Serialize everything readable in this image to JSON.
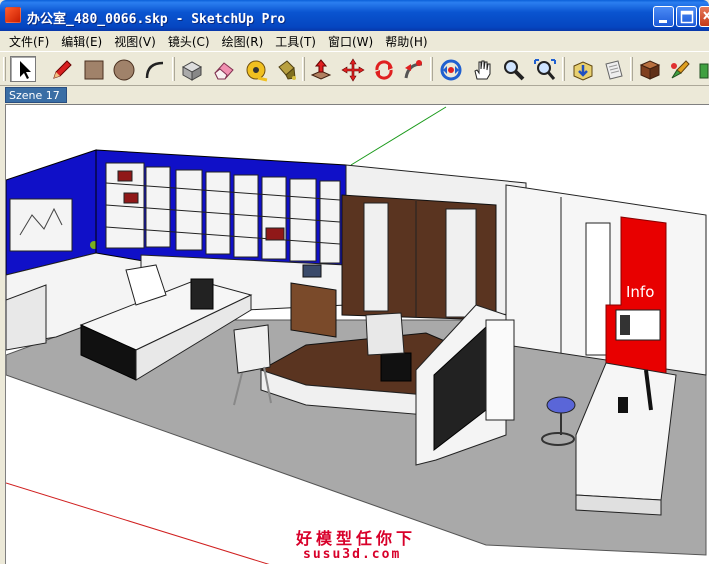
{
  "window": {
    "title": "办公室_480_0066.skp - SketchUp Pro"
  },
  "menu": [
    {
      "label": "文件(F)"
    },
    {
      "label": "编辑(E)"
    },
    {
      "label": "视图(V)"
    },
    {
      "label": "镜头(C)"
    },
    {
      "label": "绘图(R)"
    },
    {
      "label": "工具(T)"
    },
    {
      "label": "窗口(W)"
    },
    {
      "label": "帮助(H)"
    }
  ],
  "toolbar": {
    "tools": [
      "select-icon",
      "pencil-icon",
      "rectangle-icon",
      "circle-icon",
      "arc-icon",
      "make-component-icon",
      "eraser-icon",
      "tape-measure-icon",
      "paint-bucket-icon",
      "push-pull-icon",
      "move-icon",
      "rotate-icon",
      "follow-me-icon",
      "orbit-icon",
      "pan-icon",
      "zoom-icon",
      "zoom-extents-icon",
      "get-models-icon",
      "share-model-icon",
      "components-icon",
      "styles-icon",
      "more-icon"
    ],
    "active_tool": "select-icon"
  },
  "scenes": {
    "active_label": "Szene 17"
  },
  "viewport": {
    "sign_text": "Info",
    "watermark_line1": "好模型任你下",
    "watermark_line2": "susu3d.com"
  },
  "colors": {
    "accent_red": "#e80000",
    "wall_blue": "#1010c8",
    "wood_brown": "#5a3420",
    "floor_gray": "#a9a9a9",
    "titlebar_blue": "#0a54d0"
  }
}
